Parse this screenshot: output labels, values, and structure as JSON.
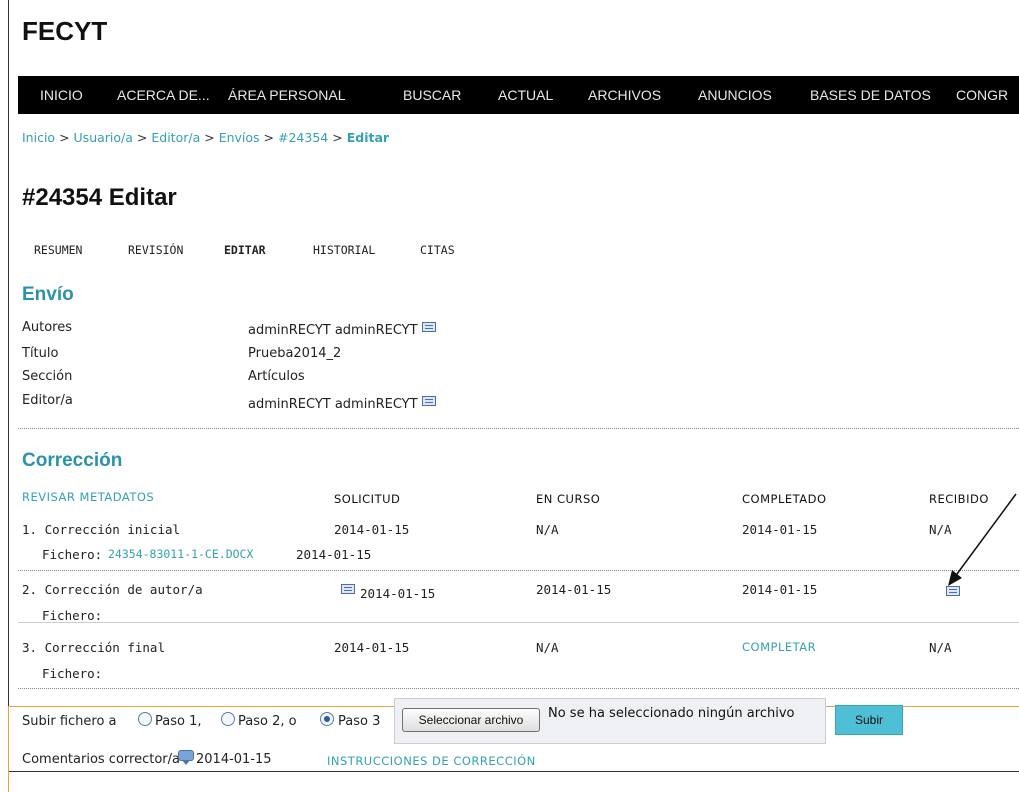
{
  "brand": "FECYT",
  "nav": [
    "INICIO",
    "ACERCA DE...",
    "ÁREA PERSONAL",
    "BUSCAR",
    "ACTUAL",
    "ARCHIVOS",
    "ANUNCIOS",
    "BASES DE DATOS",
    "CONGR"
  ],
  "breadcrumb": [
    "Inicio",
    "Usuario/a",
    "Editor/a",
    "Envíos",
    "#24354",
    "Editar"
  ],
  "breadcrumb_sep": ">",
  "page_title": "#24354 Editar",
  "tabs": [
    "RESUMEN",
    "REVISIÓN",
    "EDITAR",
    "HISTORIAL",
    "CITAS"
  ],
  "envio": {
    "heading": "Envío",
    "rows": [
      {
        "label": "Autores",
        "value": "adminRECYT adminRECYT"
      },
      {
        "label": "Título",
        "value": "Prueba2014_2"
      },
      {
        "label": "Sección",
        "value": "Artículos"
      },
      {
        "label": "Editor/a",
        "value": "adminRECYT adminRECYT"
      }
    ]
  },
  "correccion": {
    "heading": "Corrección",
    "metadata_link": "REVISAR METADATOS",
    "columns": [
      "SOLICITUD",
      "EN CURSO",
      "COMPLETADO",
      "RECIBIDO"
    ],
    "rows": [
      {
        "step": "1. Corrección inicial",
        "file_label": "Fichero:",
        "file_link": "24354-83011-1-CE.DOCX",
        "file_date": "2014-01-15",
        "solicitud": "2014-01-15",
        "en_curso": "N/A",
        "completado": "2014-01-15",
        "recibido": "N/A"
      },
      {
        "step": "2. Corrección de autor/a",
        "file_label": "Fichero:",
        "file_link": "",
        "file_date": "",
        "solicitud": "2014-01-15",
        "en_curso": "2014-01-15",
        "completado": "2014-01-15",
        "recibido": ""
      },
      {
        "step": "3. Corrección final",
        "file_label": "Fichero:",
        "file_link": "",
        "file_date": "",
        "solicitud": "2014-01-15",
        "en_curso": "N/A",
        "completado": "COMPLETAR",
        "recibido": "N/A"
      }
    ]
  },
  "upload": {
    "label": "Subir fichero a",
    "options": [
      "Paso 1,",
      "Paso 2, o",
      "Paso 3"
    ],
    "selected": "Paso 3",
    "choose_button": "Seleccionar archivo",
    "no_file_text": "No se ha seleccionado ningún archivo",
    "submit_button": "Subir"
  },
  "comments": {
    "label": "Comentarios corrector/a",
    "date": "2014-01-15",
    "instructions_link": "INSTRUCCIONES DE CORRECCIÓN"
  },
  "colors": {
    "accent": "#2a93ab",
    "link": "#33a1b5",
    "nav_bg": "#000000",
    "highlight_border": "#e8a33b",
    "upload_button": "#4fbfd6"
  }
}
